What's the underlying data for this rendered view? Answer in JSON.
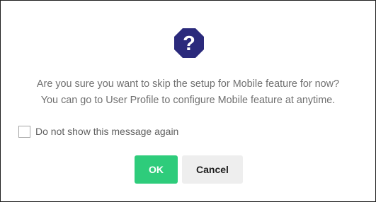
{
  "dialog": {
    "icon": "question-octagon-icon",
    "icon_glyph": "?",
    "icon_color": "#2b2a7c",
    "message_line1": "Are you sure you want to skip the setup for Mobile feature for now?",
    "message_line2": "You can go to User Profile to configure Mobile feature at anytime.",
    "dont_show_label": "Do not show this message again",
    "dont_show_checked": false,
    "ok_label": "OK",
    "cancel_label": "Cancel",
    "ok_color": "#2ecc7b",
    "cancel_color": "#eeeeee"
  }
}
